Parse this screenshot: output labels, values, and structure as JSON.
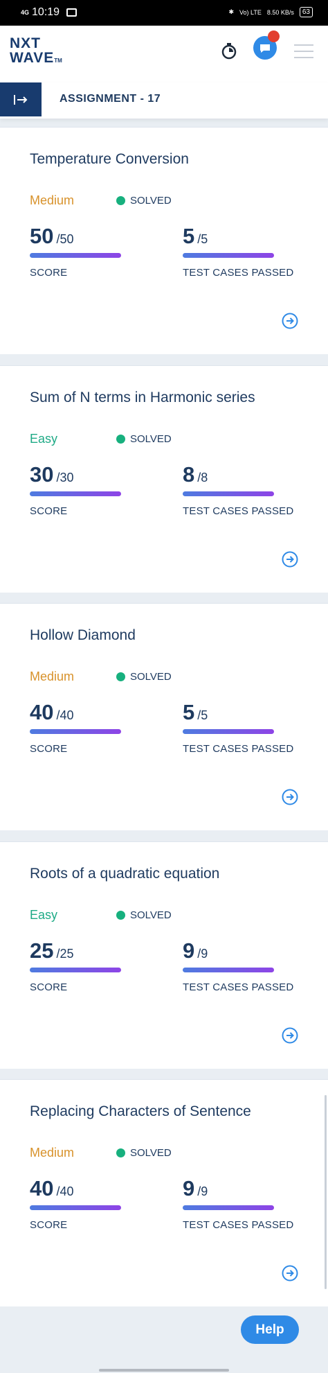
{
  "status_bar": {
    "network": "4G",
    "time": "10:19",
    "volte": "Vo) LTE",
    "speed": "8.50 KB/s",
    "battery": "63"
  },
  "header": {
    "logo_line1": "NXT",
    "logo_line2": "WAVE",
    "logo_tm": "TM"
  },
  "subheader": {
    "title": "ASSIGNMENT - 17"
  },
  "score_label": "SCORE",
  "tests_label": "TEST CASES PASSED",
  "colors": {
    "medium": "#d8922b",
    "easy": "#1faa86",
    "solved_dot": "#17b07e",
    "brand": "#183b6e",
    "accent": "#2f8ae6"
  },
  "cards": [
    {
      "title": "Temperature Conversion",
      "difficulty": "Medium",
      "status": "SOLVED",
      "score": "50",
      "score_total": "/50",
      "tests": "5",
      "tests_total": "/5"
    },
    {
      "title": "Sum of N terms in Harmonic series",
      "difficulty": "Easy",
      "status": "SOLVED",
      "score": "30",
      "score_total": "/30",
      "tests": "8",
      "tests_total": "/8"
    },
    {
      "title": "Hollow Diamond",
      "difficulty": "Medium",
      "status": "SOLVED",
      "score": "40",
      "score_total": "/40",
      "tests": "5",
      "tests_total": "/5"
    },
    {
      "title": "Roots of a quadratic equation",
      "difficulty": "Easy",
      "status": "SOLVED",
      "score": "25",
      "score_total": "/25",
      "tests": "9",
      "tests_total": "/9"
    },
    {
      "title": "Replacing Characters of Sentence",
      "difficulty": "Medium",
      "status": "SOLVED",
      "score": "40",
      "score_total": "/40",
      "tests": "9",
      "tests_total": "/9"
    }
  ],
  "help_label": "Help"
}
